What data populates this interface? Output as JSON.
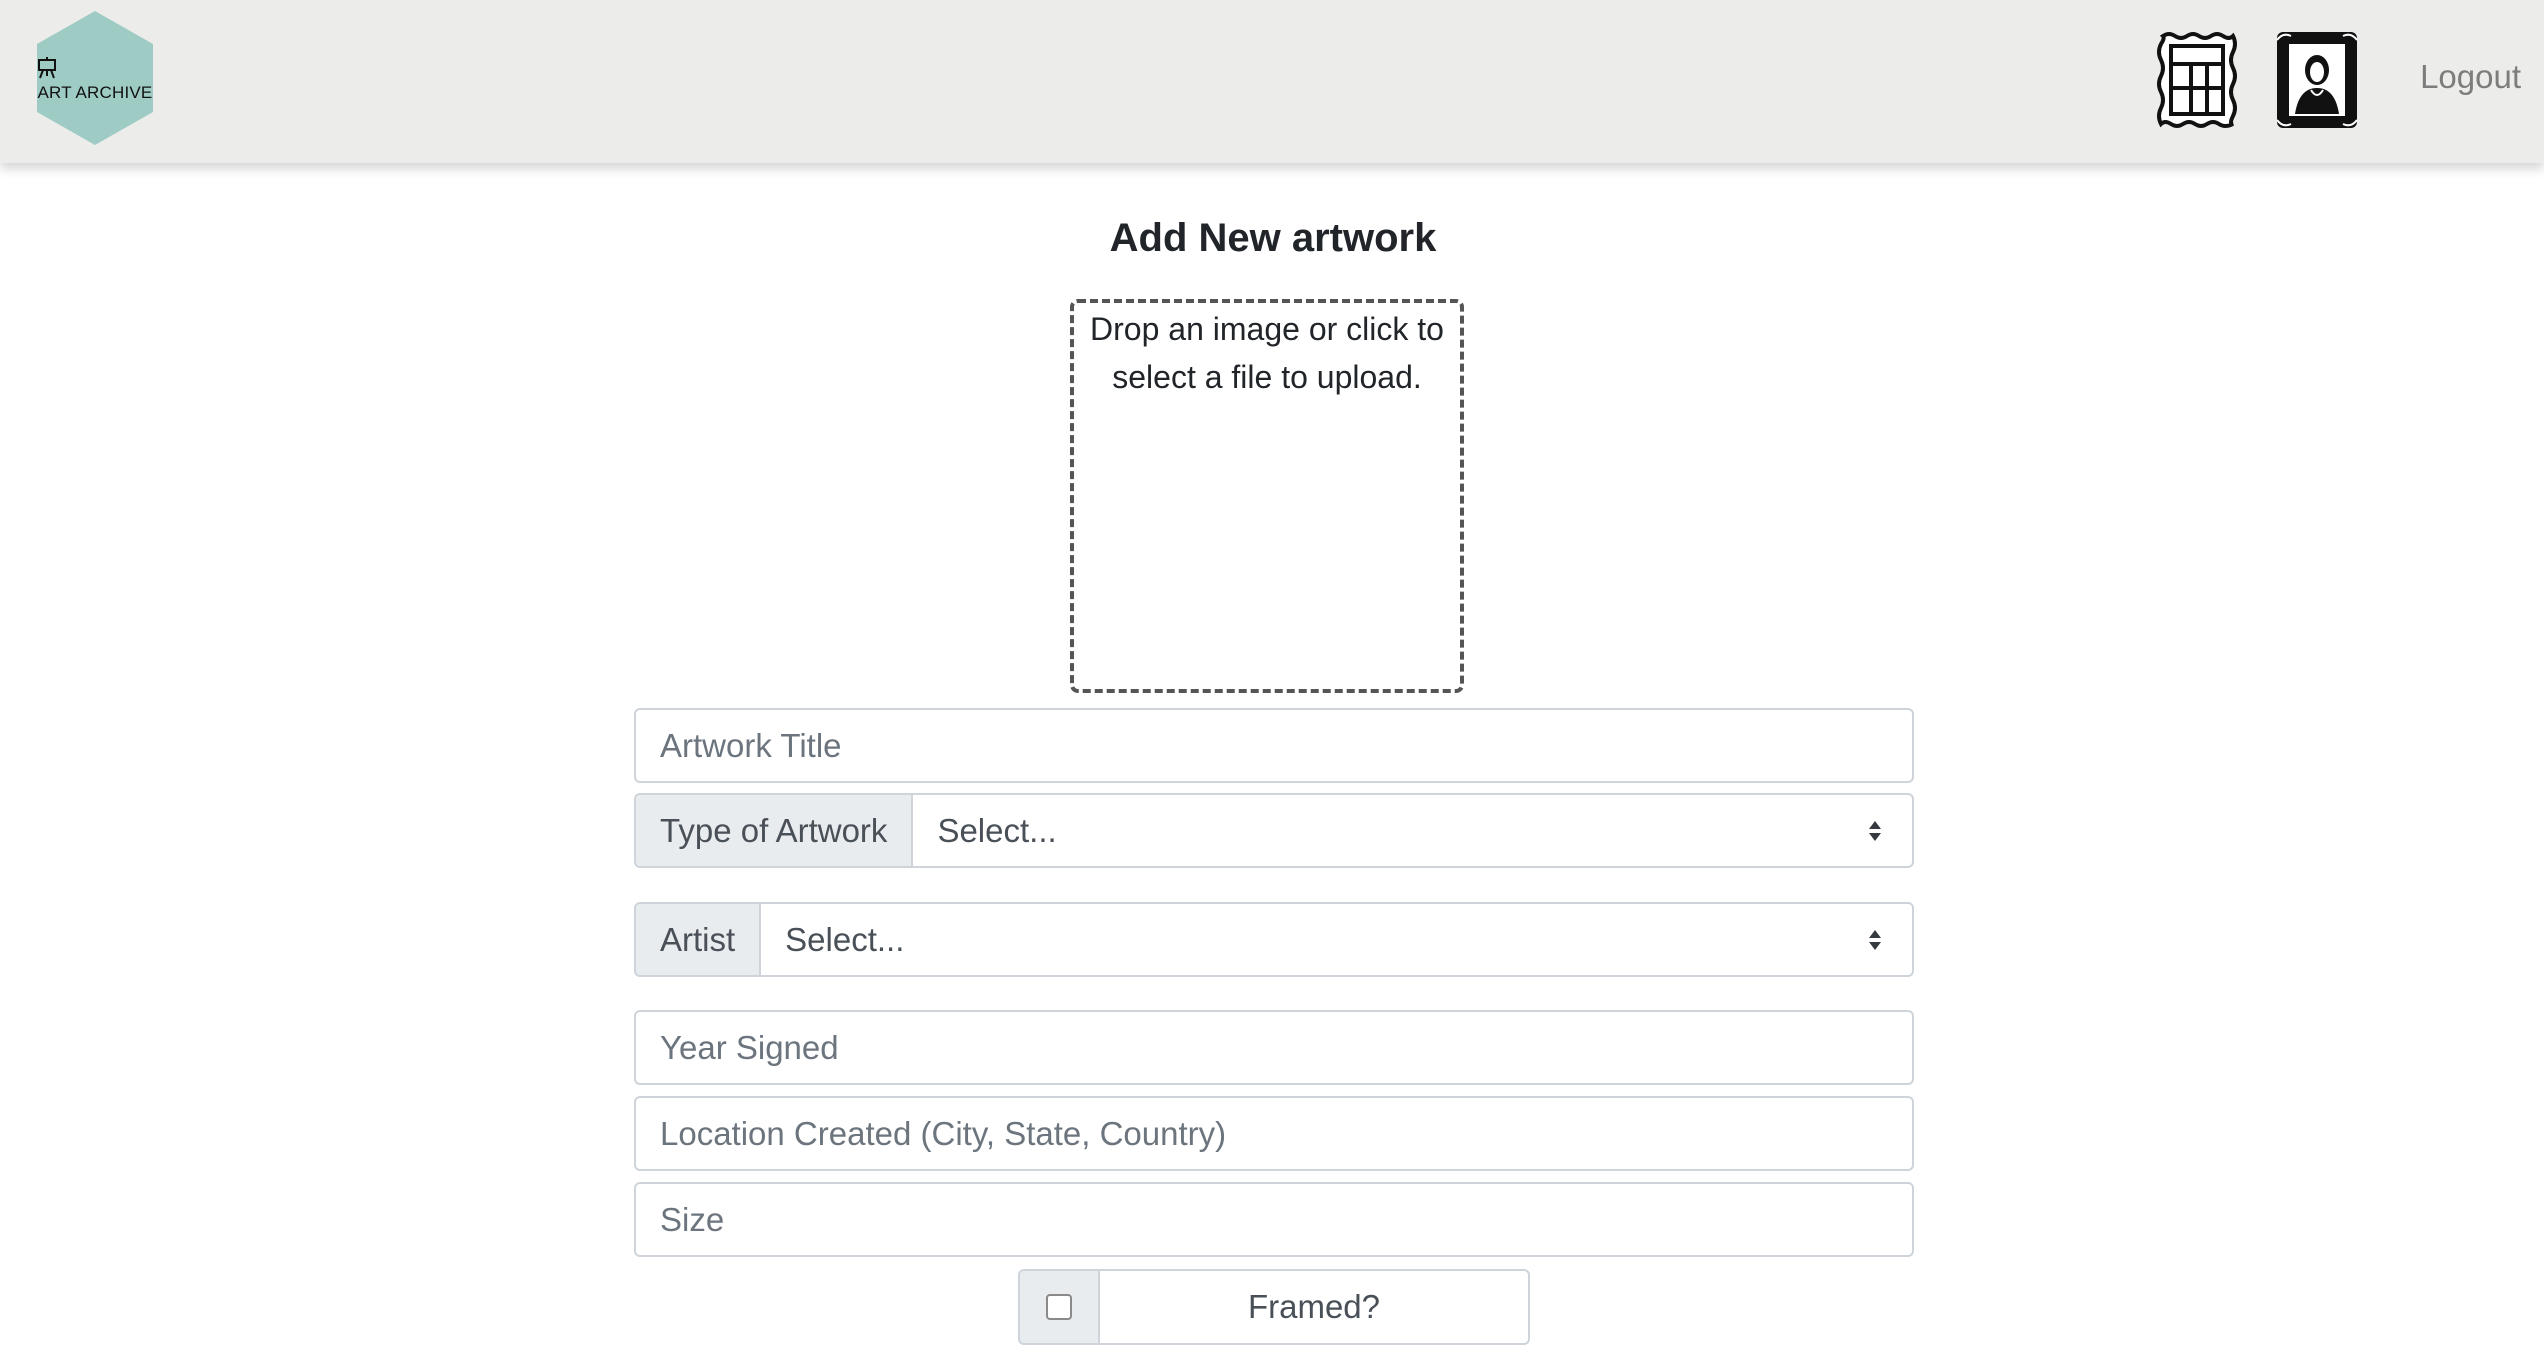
{
  "header": {
    "logo_text": "ART ARCHIVE",
    "logo_color": "#9ecbc4",
    "nav_icons": [
      "gallery-grid-icon",
      "portrait-frame-icon"
    ],
    "logout_label": "Logout"
  },
  "form": {
    "title": "Add New artwork",
    "dropzone_text": "Drop an image or click to select a file to upload.",
    "artwork_title_placeholder": "Artwork Title",
    "type_label": "Type of Artwork",
    "type_value": "Select...",
    "artist_label": "Artist",
    "artist_value": "Select...",
    "year_placeholder": "Year Signed",
    "location_placeholder": "Location Created (City, State, Country)",
    "size_placeholder": "Size",
    "framed_label": "Framed?",
    "framed_checked": false
  }
}
